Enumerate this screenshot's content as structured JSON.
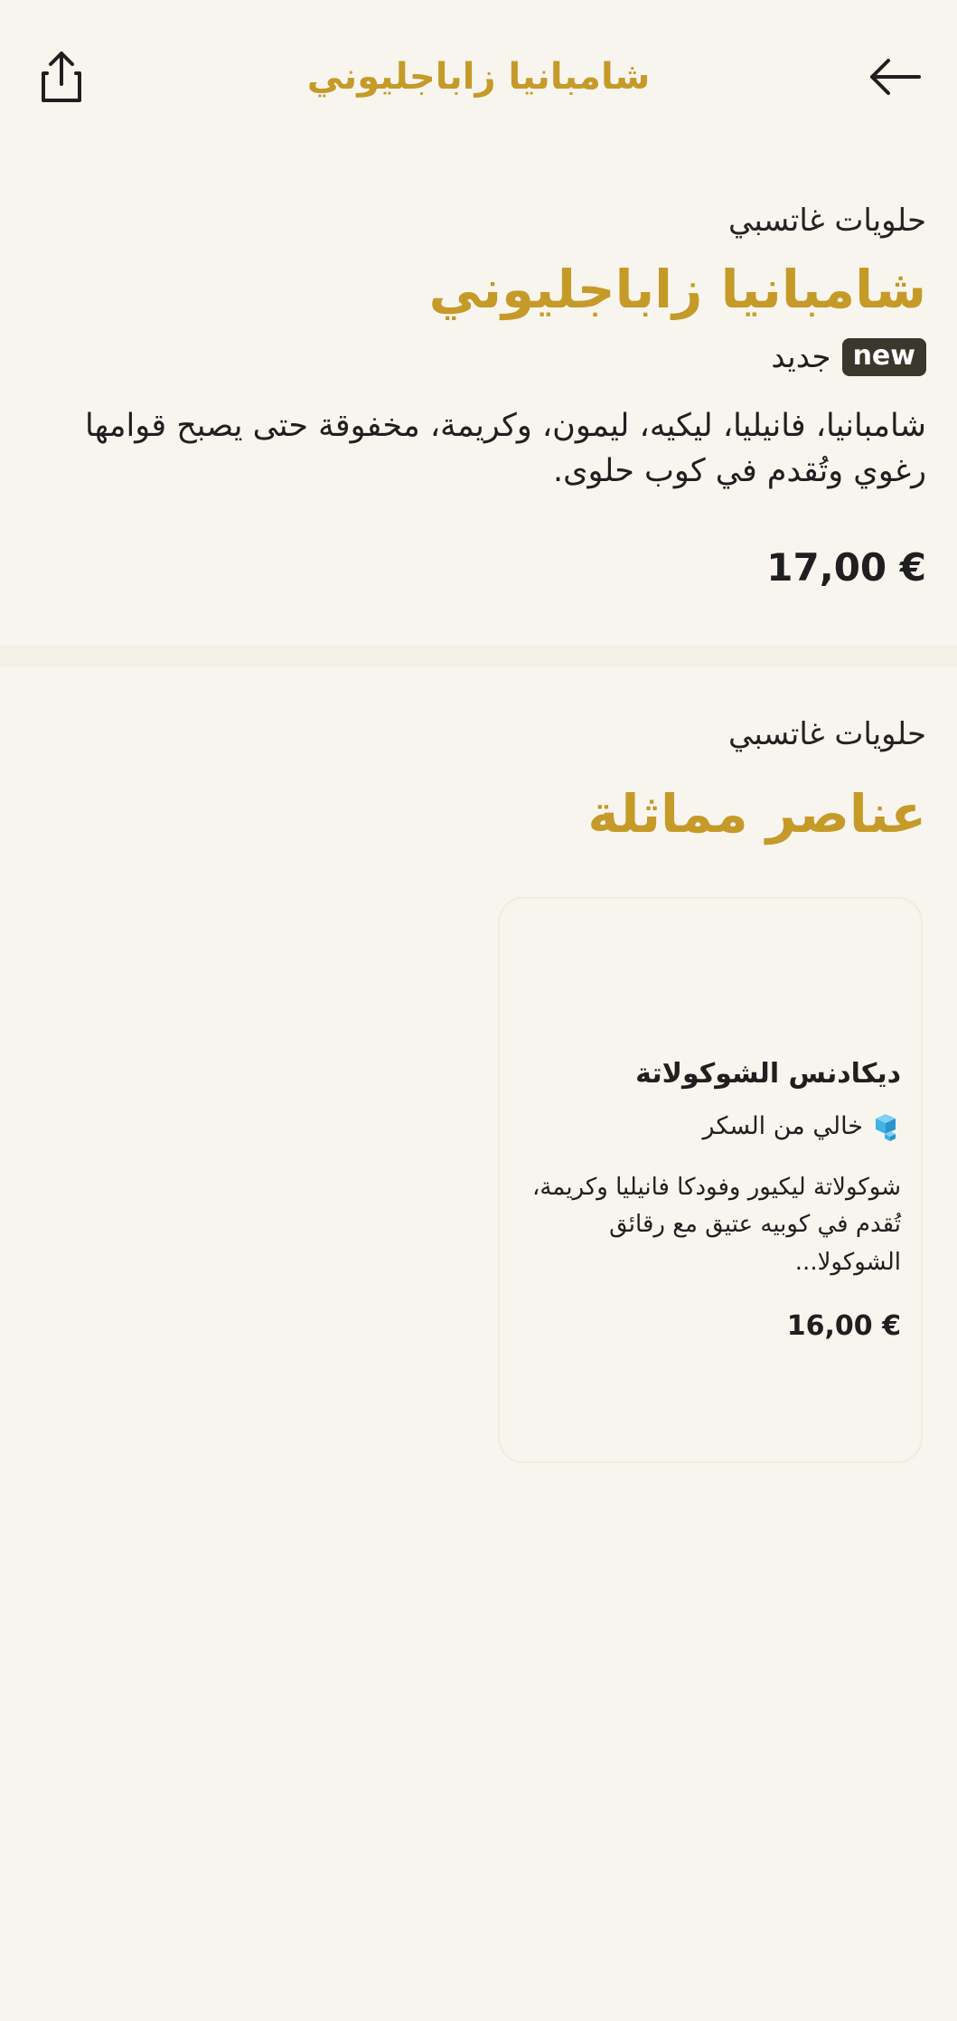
{
  "header": {
    "title": "شامبانيا زاباجليوني"
  },
  "item": {
    "store_name": "حلويات غاتسبي",
    "title": "شامبانيا زاباجليوني",
    "badge": "new",
    "new_label": "جديد",
    "description": "شامبانيا، فانيليا، ليكيه، ليمون، وكريمة، مخفوقة حتى يصبح قوامها رغوي وتُقدم في كوب حلوى.",
    "price": "17,00 €"
  },
  "similar": {
    "store_name": "حلويات غاتسبي",
    "title": "عناصر مماثلة",
    "cards": [
      {
        "title": "ديكادنس الشوكولاتة",
        "tag": "خالي من السكر",
        "description_line1": "شوكولاتة ليكيور وفودكا فانيليا وكريمة،",
        "description_line2": "تُقدم في كوبيه عتيق مع رقائق الشوكولا...",
        "price": "16,00 €"
      }
    ]
  },
  "colors": {
    "accent": "#c59a28",
    "background": "#f8f5ef",
    "badge_bg": "#3a372d",
    "sugar_icon": "#3fb3e6"
  },
  "icons": {
    "share": "share-icon",
    "back": "arrow-back-icon",
    "sugar_free": "sugar-cube-icon"
  }
}
